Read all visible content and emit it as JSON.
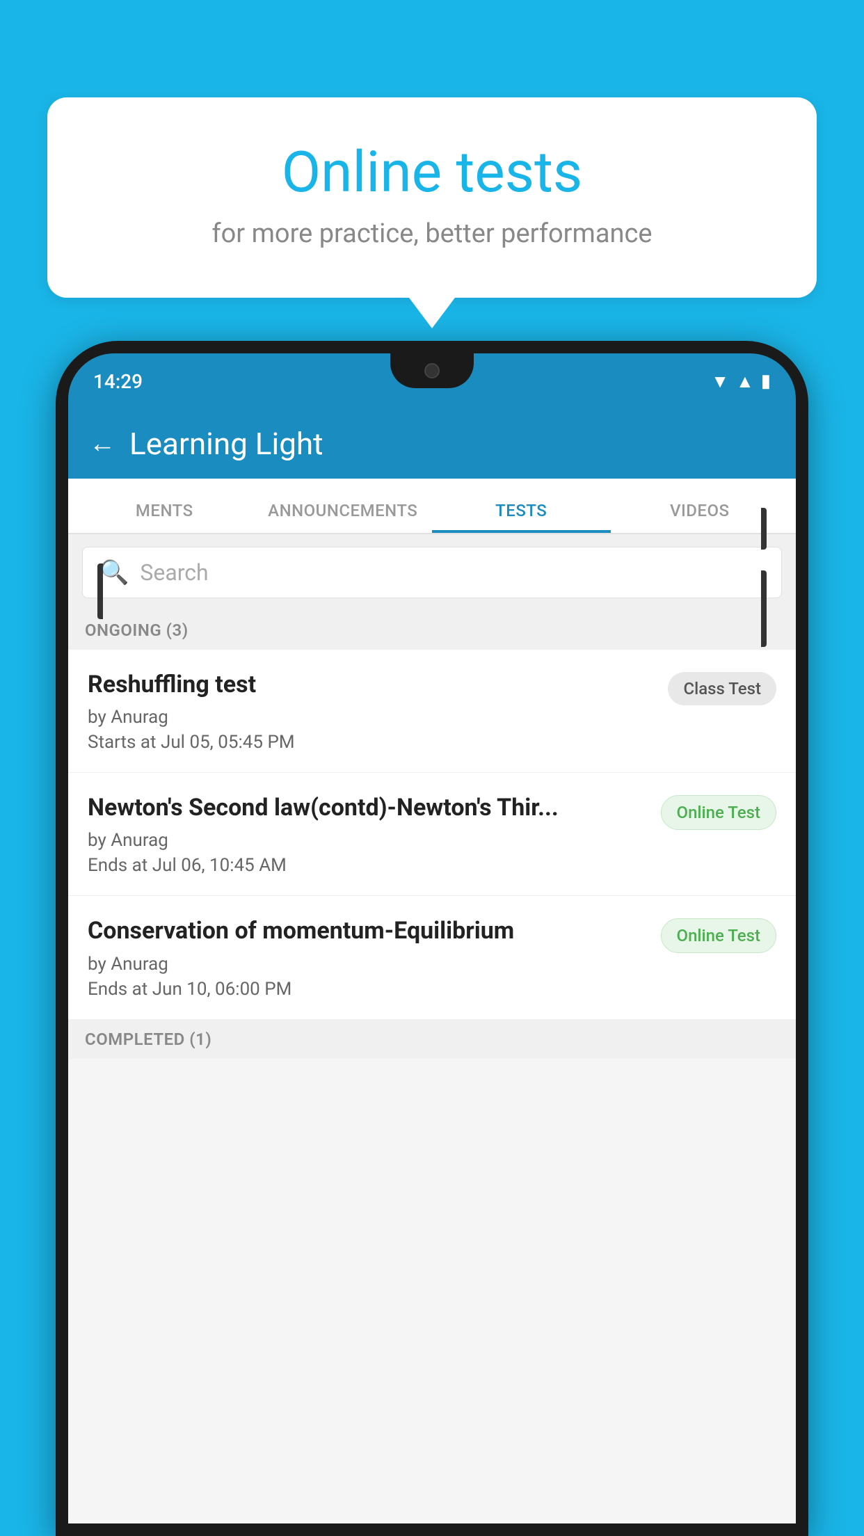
{
  "background_color": "#1ab5e8",
  "speech_bubble": {
    "title": "Online tests",
    "subtitle": "for more practice, better performance"
  },
  "phone": {
    "time": "14:29",
    "status_icons": [
      "wifi",
      "signal",
      "battery"
    ]
  },
  "app": {
    "title": "Learning Light",
    "back_label": "←"
  },
  "tabs": [
    {
      "label": "MENTS",
      "active": false
    },
    {
      "label": "ANNOUNCEMENTS",
      "active": false
    },
    {
      "label": "TESTS",
      "active": true
    },
    {
      "label": "VIDEOS",
      "active": false
    }
  ],
  "search": {
    "placeholder": "Search",
    "icon": "🔍"
  },
  "ongoing_section": {
    "label": "ONGOING (3)"
  },
  "tests": [
    {
      "name": "Reshuffling test",
      "author": "by Anurag",
      "time": "Starts at  Jul 05, 05:45 PM",
      "badge": "Class Test",
      "badge_type": "class"
    },
    {
      "name": "Newton's Second law(contd)-Newton's Thir...",
      "author": "by Anurag",
      "time": "Ends at  Jul 06, 10:45 AM",
      "badge": "Online Test",
      "badge_type": "online"
    },
    {
      "name": "Conservation of momentum-Equilibrium",
      "author": "by Anurag",
      "time": "Ends at  Jun 10, 06:00 PM",
      "badge": "Online Test",
      "badge_type": "online"
    }
  ],
  "completed_section": {
    "label": "COMPLETED (1)"
  }
}
